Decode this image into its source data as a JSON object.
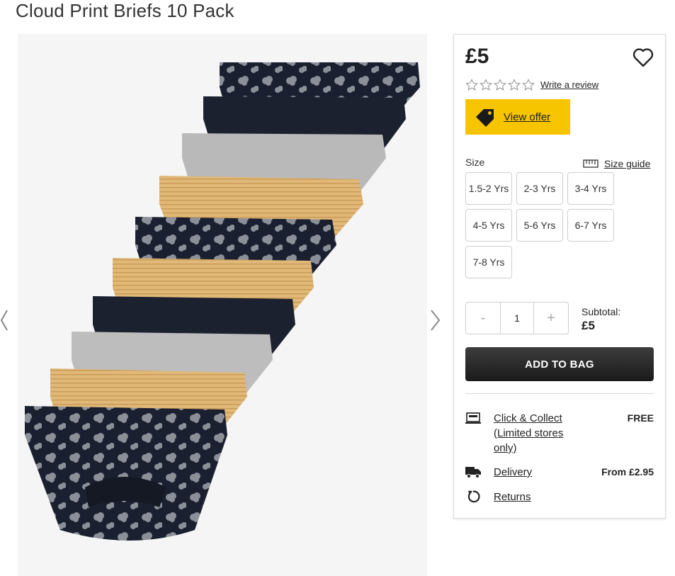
{
  "product": {
    "title": "Cloud Print Briefs 10 Pack",
    "price": "£5"
  },
  "rating": {
    "stars_filled": 0,
    "stars_total": 5,
    "write_review_label": "Write a review"
  },
  "offer": {
    "label": "View offer",
    "color": "#f7c400"
  },
  "size": {
    "label": "Size",
    "guide_label": "Size guide",
    "options": [
      "1.5-2 Yrs",
      "2-3 Yrs",
      "3-4 Yrs",
      "4-5 Yrs",
      "5-6 Yrs",
      "6-7 Yrs",
      "7-8 Yrs"
    ]
  },
  "quantity": {
    "minus": "-",
    "value": "1",
    "plus": "+"
  },
  "subtotal": {
    "label": "Subtotal:",
    "amount": "£5"
  },
  "add_to_bag_label": "ADD TO BAG",
  "delivery": {
    "click_collect": {
      "label": "Click & Collect (Limited stores only)",
      "value": "FREE"
    },
    "delivery": {
      "label": "Delivery",
      "value": "From £2.95"
    },
    "returns": {
      "label": "Returns"
    }
  },
  "icons": {
    "favourite": "heart-icon",
    "offer": "tag-icon",
    "size_guide": "ruler-icon",
    "collect": "store-icon",
    "delivery": "truck-icon",
    "returns": "return-icon",
    "prev": "chevron-left-icon",
    "next": "chevron-right-icon"
  }
}
